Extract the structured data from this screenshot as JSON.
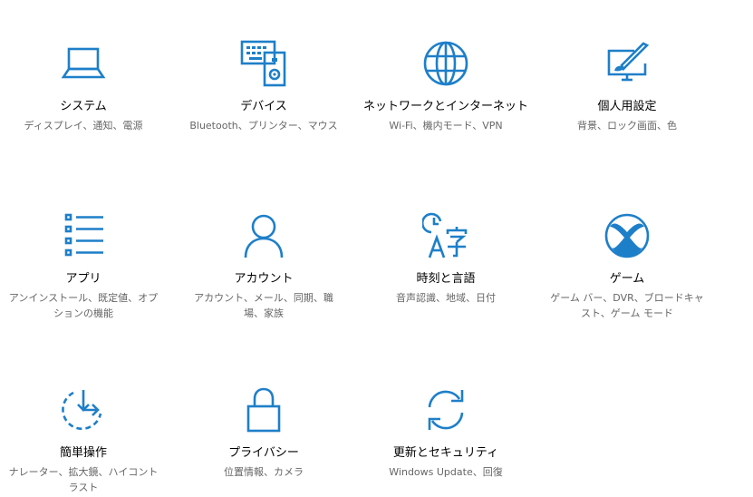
{
  "accent_color": "#1e7fc9",
  "tiles": [
    {
      "icon": "laptop-icon",
      "title": "システム",
      "desc": "ディスプレイ、通知、電源"
    },
    {
      "icon": "devices-icon",
      "title": "デバイス",
      "desc": "Bluetooth、プリンター、マウス"
    },
    {
      "icon": "globe-icon",
      "title": "ネットワークとインターネット",
      "desc": "Wi-Fi、機内モード、VPN"
    },
    {
      "icon": "personalization-icon",
      "title": "個人用設定",
      "desc": "背景、ロック画面、色"
    },
    {
      "icon": "apps-list-icon",
      "title": "アプリ",
      "desc": "アンインストール、既定値、オプションの機能"
    },
    {
      "icon": "person-icon",
      "title": "アカウント",
      "desc": "アカウント、メール、同期、職場、家族"
    },
    {
      "icon": "time-language-icon",
      "title": "時刻と言語",
      "desc": "音声認識、地域、日付"
    },
    {
      "icon": "xbox-icon",
      "title": "ゲーム",
      "desc": "ゲーム バー、DVR、ブロードキャスト、ゲーム モード"
    },
    {
      "icon": "ease-of-access-icon",
      "title": "簡単操作",
      "desc": "ナレーター、拡大鏡、ハイコントラスト"
    },
    {
      "icon": "lock-icon",
      "title": "プライバシー",
      "desc": "位置情報、カメラ"
    },
    {
      "icon": "sync-icon",
      "title": "更新とセキュリティ",
      "desc": "Windows Update、回復"
    }
  ]
}
